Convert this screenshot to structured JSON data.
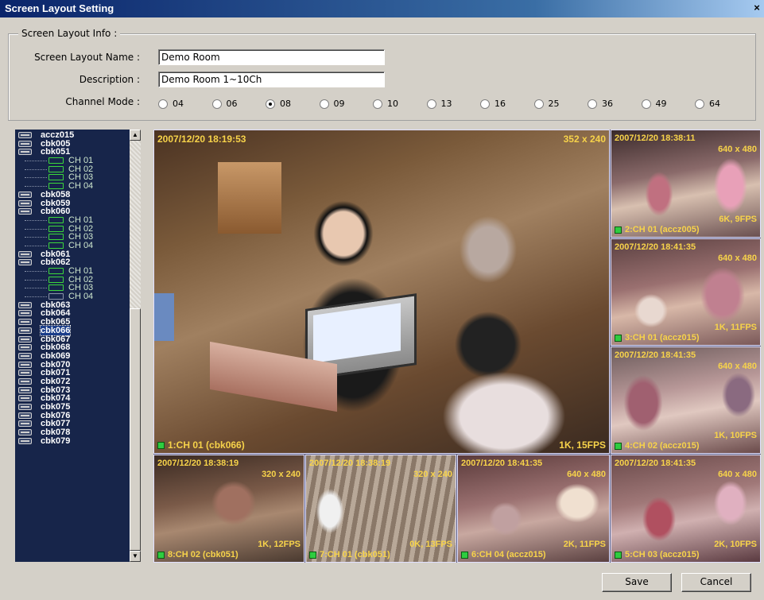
{
  "window": {
    "title": "Screen Layout Setting",
    "close_glyph": "×"
  },
  "layout_info": {
    "legend": "Screen Layout Info :",
    "name_label": "Screen Layout Name :",
    "name_value": "Demo Room",
    "desc_label": "Description :",
    "desc_value": "Demo Room 1~10Ch",
    "mode_label": "Channel Mode :",
    "modes": [
      "04",
      "06",
      "08",
      "09",
      "10",
      "13",
      "16",
      "25",
      "36",
      "49",
      "64"
    ],
    "selected_mode": "08"
  },
  "device_tree": [
    {
      "label": "accz015"
    },
    {
      "label": "cbk005"
    },
    {
      "label": "cbk051"
    },
    {
      "label": "CH 01",
      "child": true
    },
    {
      "label": "CH 02",
      "child": true
    },
    {
      "label": "CH 03",
      "child": true
    },
    {
      "label": "CH 04",
      "child": true
    },
    {
      "label": "cbk058"
    },
    {
      "label": "cbk059"
    },
    {
      "label": "cbk060"
    },
    {
      "label": "CH 01",
      "child": true
    },
    {
      "label": "CH 02",
      "child": true
    },
    {
      "label": "CH 03",
      "child": true
    },
    {
      "label": "CH 04",
      "child": true
    },
    {
      "label": "cbk061"
    },
    {
      "label": "cbk062"
    },
    {
      "label": "CH 01",
      "child": true
    },
    {
      "label": "CH 02",
      "child": true
    },
    {
      "label": "CH 03",
      "child": true
    },
    {
      "label": "CH 04",
      "child": true,
      "off": true
    },
    {
      "label": "cbk063"
    },
    {
      "label": "cbk064"
    },
    {
      "label": "cbk065"
    },
    {
      "label": "cbk066",
      "selected": true
    },
    {
      "label": "cbk067"
    },
    {
      "label": "cbk068"
    },
    {
      "label": "cbk069"
    },
    {
      "label": "cbk070"
    },
    {
      "label": "cbk071"
    },
    {
      "label": "cbk072"
    },
    {
      "label": "cbk073"
    },
    {
      "label": "cbk074"
    },
    {
      "label": "cbk075"
    },
    {
      "label": "cbk076"
    },
    {
      "label": "cbk077"
    },
    {
      "label": "cbk078"
    },
    {
      "label": "cbk079"
    }
  ],
  "cameras": {
    "main": {
      "ts": "2007/12/20 18:19:53",
      "res": "352 x 240",
      "ch": "1:CH 01 (cbk066)",
      "fps": "1K, 15FPS"
    },
    "r1": {
      "ts": "2007/12/20 18:38:11",
      "res": "640 x 480",
      "ch": "2:CH 01 (accz005)",
      "fps": "6K, 9FPS"
    },
    "r2": {
      "ts": "2007/12/20 18:41:35",
      "res": "640 x 480",
      "ch": "3:CH 01 (accz015)",
      "fps": "1K, 11FPS"
    },
    "r3": {
      "ts": "2007/12/20 18:41:35",
      "res": "640 x 480",
      "ch": "4:CH 02 (accz015)",
      "fps": "1K, 10FPS"
    },
    "b1": {
      "ts": "2007/12/20 18:38:19",
      "res": "320 x 240",
      "ch": "8:CH 02 (cbk051)",
      "fps": "1K, 12FPS"
    },
    "b2": {
      "ts": "2007/12/20 18:38:19",
      "res": "320 x 240",
      "ch": "7:CH 01 (cbk051)",
      "fps": "0K, 13FPS"
    },
    "b3": {
      "ts": "2007/12/20 18:41:35",
      "res": "640 x 480",
      "ch": "6:CH 04 (accz015)",
      "fps": "2K, 11FPS"
    },
    "b4": {
      "ts": "2007/12/20 18:41:35",
      "res": "640 x 480",
      "ch": "5:CH 03 (accz015)",
      "fps": "2K, 10FPS"
    }
  },
  "buttons": {
    "save": "Save",
    "cancel": "Cancel"
  },
  "colors": {
    "osd_text": "#f7d34a",
    "channel_active": "#2ecc40",
    "tree_bg": "#17254a"
  }
}
